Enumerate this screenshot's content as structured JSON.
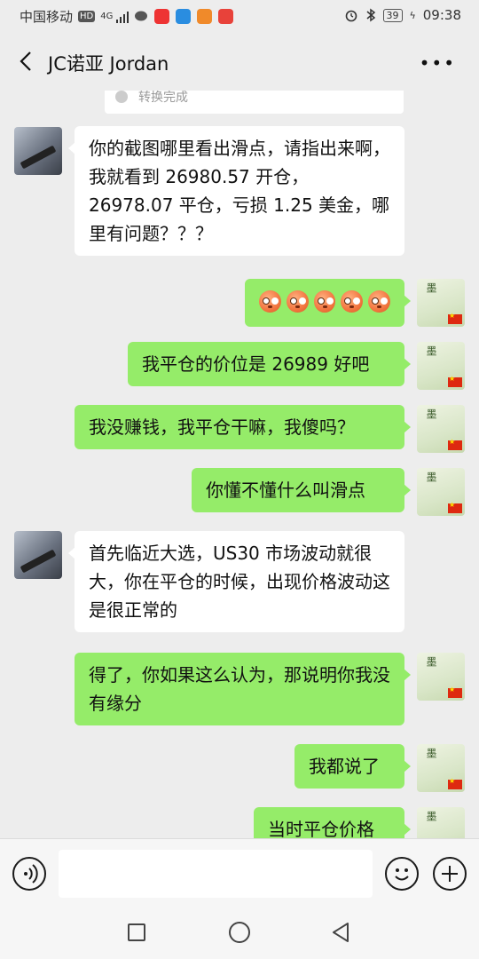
{
  "status_bar": {
    "carrier": "中国移动",
    "hd": "HD",
    "network": "4G",
    "battery": "39",
    "time": "09:38"
  },
  "header": {
    "title": "JC诺亚 Jordan",
    "more": "•••"
  },
  "system_note": "转换完成",
  "messages": [
    {
      "side": "left",
      "text": "你的截图哪里看出滑点，请指出来啊，我就看到 26980.57 开仓，26978.07 平仓，亏损 1.25 美金，哪里有问题？？？"
    },
    {
      "side": "right",
      "type": "emoji",
      "emoji_count": 5
    },
    {
      "side": "right",
      "text": "我平仓的价位是 26989 好吧"
    },
    {
      "side": "right",
      "text": "我没赚钱，我平仓干嘛，我傻吗？"
    },
    {
      "side": "right",
      "text": "你懂不懂什么叫滑点"
    },
    {
      "side": "left",
      "text": "首先临近大选，US30 市场波动就很大，你在平仓的时候，出现价格波动这是很正常的"
    },
    {
      "side": "right",
      "text": "得了，你如果这么认为，那说明你我没有缘分"
    },
    {
      "side": "right",
      "text": "我都说了"
    },
    {
      "side": "right",
      "text": "当时平仓价格"
    }
  ],
  "icons": {
    "back": "chevron-left-icon",
    "voice": "voice-icon",
    "emoji": "emoji-icon",
    "plus": "plus-icon"
  },
  "colors": {
    "bg": "#ededed",
    "bubble_sent": "#95ec69",
    "bubble_received": "#ffffff"
  }
}
